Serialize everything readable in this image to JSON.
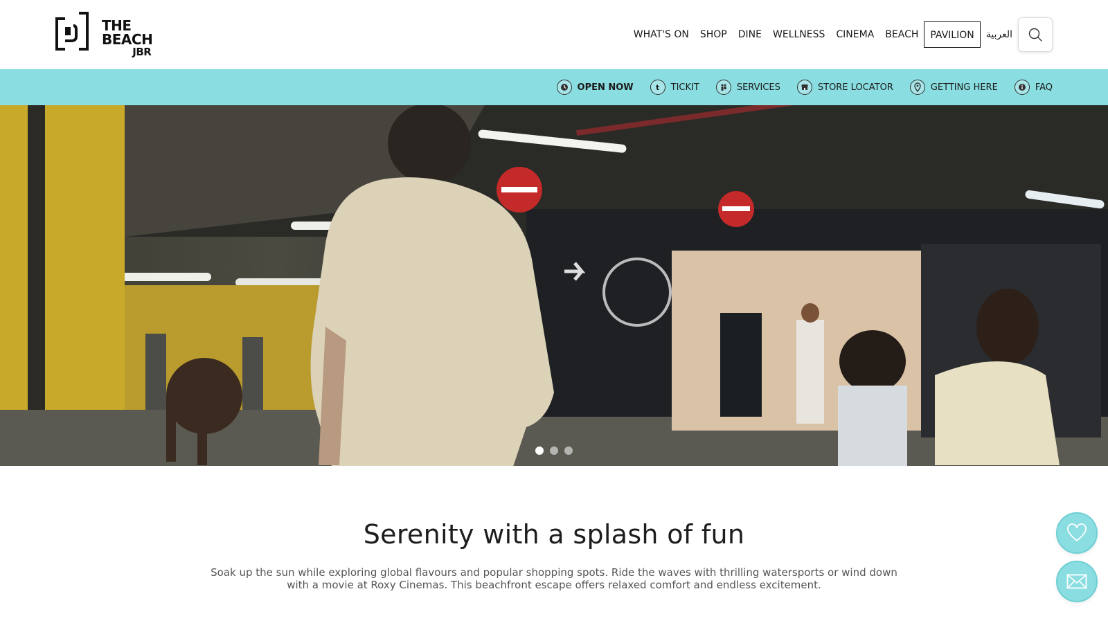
{
  "header": {
    "logo": {
      "line1": "THE",
      "line2": "BEACH",
      "line3": "JBR",
      "icon": "the-beach-mark-icon"
    },
    "nav": [
      {
        "label": "WHAT'S ON"
      },
      {
        "label": "SHOP"
      },
      {
        "label": "DINE"
      },
      {
        "label": "WELLNESS"
      },
      {
        "label": "CINEMA"
      },
      {
        "label": "BEACH"
      },
      {
        "label": "PAVILION"
      },
      {
        "label": "العربية"
      }
    ],
    "search_icon": "search-icon"
  },
  "subbar": {
    "bg_color": "#8adde0",
    "items": [
      {
        "label": "OPEN NOW",
        "icon": "clock-icon"
      },
      {
        "label": "TICKIT",
        "icon": "tickit-icon"
      },
      {
        "label": "SERVICES",
        "icon": "services-icon"
      },
      {
        "label": "STORE LOCATOR",
        "icon": "store-icon"
      },
      {
        "label": "GETTING HERE",
        "icon": "location-pin-icon"
      },
      {
        "label": "FAQ",
        "icon": "info-icon"
      }
    ]
  },
  "hero": {
    "slides": 3,
    "active_slide": 1
  },
  "content": {
    "headline": "Serenity with a splash of fun",
    "intro": "Soak up the sun while exploring global flavours and popular shopping spots. Ride the waves with thrilling watersports or wind down with a movie at Roxy Cinemas. This beachfront escape offers relaxed comfort and endless excitement."
  },
  "floating": {
    "favorites_icon": "heart-icon",
    "contact_icon": "mail-icon",
    "color": "#8adde0"
  }
}
